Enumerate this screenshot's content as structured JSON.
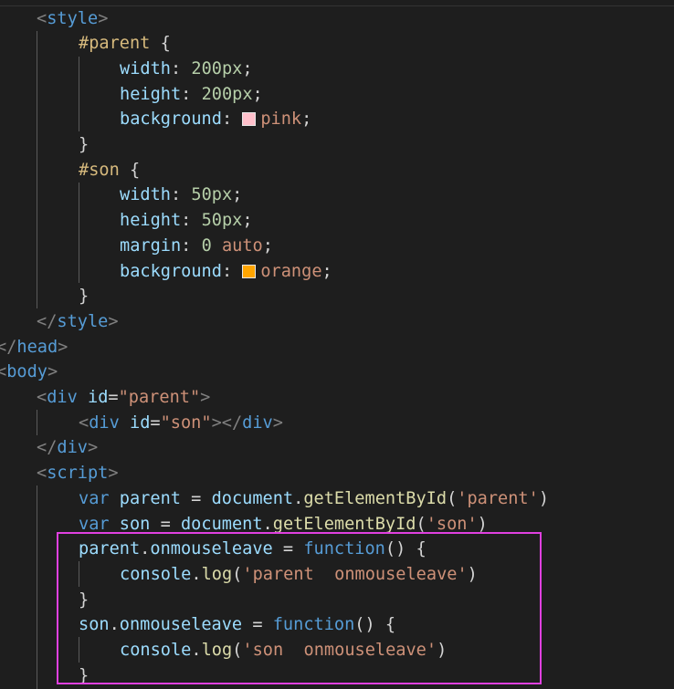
{
  "editor": {
    "highlight_color": "#e040e0",
    "lines": [
      {
        "indent": 1,
        "tokens": [
          {
            "t": "<",
            "c": "punct"
          },
          {
            "t": "style",
            "c": "tag"
          },
          {
            "t": ">",
            "c": "punct"
          }
        ]
      },
      {
        "indent": 2,
        "tokens": [
          {
            "t": "#parent",
            "c": "sel"
          },
          {
            "t": " {",
            "c": "plain"
          }
        ]
      },
      {
        "indent": 3,
        "tokens": [
          {
            "t": "width",
            "c": "prop"
          },
          {
            "t": ": ",
            "c": "plain"
          },
          {
            "t": "200px",
            "c": "num"
          },
          {
            "t": ";",
            "c": "plain"
          }
        ]
      },
      {
        "indent": 3,
        "tokens": [
          {
            "t": "height",
            "c": "prop"
          },
          {
            "t": ": ",
            "c": "plain"
          },
          {
            "t": "200px",
            "c": "num"
          },
          {
            "t": ";",
            "c": "plain"
          }
        ]
      },
      {
        "indent": 3,
        "tokens": [
          {
            "t": "background",
            "c": "prop"
          },
          {
            "t": ": ",
            "c": "plain"
          },
          {
            "swatch": "#ffc0cb"
          },
          {
            "t": "pink",
            "c": "val"
          },
          {
            "t": ";",
            "c": "plain"
          }
        ]
      },
      {
        "indent": 2,
        "tokens": [
          {
            "t": "}",
            "c": "plain"
          }
        ]
      },
      {
        "indent": 2,
        "tokens": [
          {
            "t": "#son",
            "c": "sel"
          },
          {
            "t": " {",
            "c": "plain"
          }
        ]
      },
      {
        "indent": 3,
        "tokens": [
          {
            "t": "width",
            "c": "prop"
          },
          {
            "t": ": ",
            "c": "plain"
          },
          {
            "t": "50px",
            "c": "num"
          },
          {
            "t": ";",
            "c": "plain"
          }
        ]
      },
      {
        "indent": 3,
        "tokens": [
          {
            "t": "height",
            "c": "prop"
          },
          {
            "t": ": ",
            "c": "plain"
          },
          {
            "t": "50px",
            "c": "num"
          },
          {
            "t": ";",
            "c": "plain"
          }
        ]
      },
      {
        "indent": 3,
        "tokens": [
          {
            "t": "margin",
            "c": "prop"
          },
          {
            "t": ": ",
            "c": "plain"
          },
          {
            "t": "0",
            "c": "num"
          },
          {
            "t": " ",
            "c": "plain"
          },
          {
            "t": "auto",
            "c": "val"
          },
          {
            "t": ";",
            "c": "plain"
          }
        ]
      },
      {
        "indent": 3,
        "tokens": [
          {
            "t": "background",
            "c": "prop"
          },
          {
            "t": ": ",
            "c": "plain"
          },
          {
            "swatch": "#ffa500"
          },
          {
            "t": "orange",
            "c": "val"
          },
          {
            "t": ";",
            "c": "plain"
          }
        ]
      },
      {
        "indent": 2,
        "tokens": [
          {
            "t": "}",
            "c": "plain"
          }
        ]
      },
      {
        "indent": 1,
        "tokens": [
          {
            "t": "</",
            "c": "punct"
          },
          {
            "t": "style",
            "c": "tag"
          },
          {
            "t": ">",
            "c": "punct"
          }
        ]
      },
      {
        "indent": 0,
        "tokens": [
          {
            "t": "</",
            "c": "punct"
          },
          {
            "t": "head",
            "c": "tag"
          },
          {
            "t": ">",
            "c": "punct"
          }
        ]
      },
      {
        "indent": 0,
        "tokens": [
          {
            "t": "<",
            "c": "punct"
          },
          {
            "t": "body",
            "c": "tag"
          },
          {
            "t": ">",
            "c": "punct"
          }
        ]
      },
      {
        "indent": 1,
        "tokens": [
          {
            "t": "<",
            "c": "punct"
          },
          {
            "t": "div",
            "c": "tag"
          },
          {
            "t": " ",
            "c": "plain"
          },
          {
            "t": "id",
            "c": "attr"
          },
          {
            "t": "=",
            "c": "plain"
          },
          {
            "t": "\"parent\"",
            "c": "str"
          },
          {
            "t": ">",
            "c": "punct"
          }
        ]
      },
      {
        "indent": 2,
        "tokens": [
          {
            "t": "<",
            "c": "punct"
          },
          {
            "t": "div",
            "c": "tag"
          },
          {
            "t": " ",
            "c": "plain"
          },
          {
            "t": "id",
            "c": "attr"
          },
          {
            "t": "=",
            "c": "plain"
          },
          {
            "t": "\"son\"",
            "c": "str"
          },
          {
            "t": "></",
            "c": "punct"
          },
          {
            "t": "div",
            "c": "tag"
          },
          {
            "t": ">",
            "c": "punct"
          }
        ]
      },
      {
        "indent": 1,
        "tokens": [
          {
            "t": "</",
            "c": "punct"
          },
          {
            "t": "div",
            "c": "tag"
          },
          {
            "t": ">",
            "c": "punct"
          }
        ]
      },
      {
        "indent": 1,
        "tokens": [
          {
            "t": "<",
            "c": "punct"
          },
          {
            "t": "script",
            "c": "tag"
          },
          {
            "t": ">",
            "c": "punct"
          }
        ]
      },
      {
        "indent": 2,
        "tokens": [
          {
            "t": "var",
            "c": "kw"
          },
          {
            "t": " ",
            "c": "plain"
          },
          {
            "t": "parent",
            "c": "var"
          },
          {
            "t": " = ",
            "c": "plain"
          },
          {
            "t": "document",
            "c": "var"
          },
          {
            "t": ".",
            "c": "plain"
          },
          {
            "t": "getElementById",
            "c": "fn"
          },
          {
            "t": "(",
            "c": "plain"
          },
          {
            "t": "'parent'",
            "c": "str"
          },
          {
            "t": ")",
            "c": "plain"
          }
        ]
      },
      {
        "indent": 2,
        "tokens": [
          {
            "t": "var",
            "c": "kw"
          },
          {
            "t": " ",
            "c": "plain"
          },
          {
            "t": "son",
            "c": "var"
          },
          {
            "t": " = ",
            "c": "plain"
          },
          {
            "t": "document",
            "c": "var"
          },
          {
            "t": ".",
            "c": "plain"
          },
          {
            "t": "getElementById",
            "c": "fn"
          },
          {
            "t": "(",
            "c": "plain"
          },
          {
            "t": "'son'",
            "c": "str"
          },
          {
            "t": ")",
            "c": "plain"
          }
        ]
      },
      {
        "indent": 2,
        "tokens": [
          {
            "t": "parent",
            "c": "var"
          },
          {
            "t": ".",
            "c": "plain"
          },
          {
            "t": "onmouseleave",
            "c": "var"
          },
          {
            "t": " = ",
            "c": "plain"
          },
          {
            "t": "function",
            "c": "kw"
          },
          {
            "t": "() {",
            "c": "plain"
          }
        ]
      },
      {
        "indent": 3,
        "tokens": [
          {
            "t": "console",
            "c": "var"
          },
          {
            "t": ".",
            "c": "plain"
          },
          {
            "t": "log",
            "c": "fn"
          },
          {
            "t": "(",
            "c": "plain"
          },
          {
            "t": "'parent  onmouseleave'",
            "c": "str"
          },
          {
            "t": ")",
            "c": "plain"
          }
        ]
      },
      {
        "indent": 2,
        "tokens": [
          {
            "t": "}",
            "c": "plain"
          }
        ]
      },
      {
        "indent": 2,
        "tokens": [
          {
            "t": "son",
            "c": "var"
          },
          {
            "t": ".",
            "c": "plain"
          },
          {
            "t": "onmouseleave",
            "c": "var"
          },
          {
            "t": " = ",
            "c": "plain"
          },
          {
            "t": "function",
            "c": "kw"
          },
          {
            "t": "() {",
            "c": "plain"
          }
        ]
      },
      {
        "indent": 3,
        "tokens": [
          {
            "t": "console",
            "c": "var"
          },
          {
            "t": ".",
            "c": "plain"
          },
          {
            "t": "log",
            "c": "fn"
          },
          {
            "t": "(",
            "c": "plain"
          },
          {
            "t": "'son  onmouseleave'",
            "c": "str"
          },
          {
            "t": ")",
            "c": "plain"
          }
        ]
      },
      {
        "indent": 2,
        "tokens": [
          {
            "t": "}",
            "c": "plain"
          }
        ]
      }
    ]
  }
}
